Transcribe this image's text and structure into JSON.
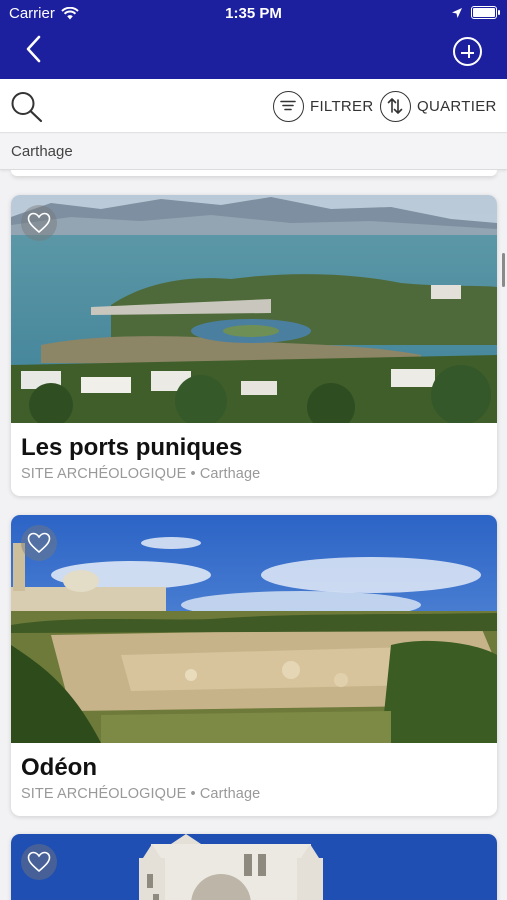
{
  "status_bar": {
    "carrier": "Carrier",
    "time": "1:35 PM"
  },
  "header": {
    "back_icon": "chevron-left-icon",
    "add_icon": "plus-circle-icon"
  },
  "toolbar": {
    "search_icon": "search-icon",
    "filter_label": "FILTRER",
    "quarter_label": "QUARTIER"
  },
  "location": "Carthage",
  "cards": [
    {
      "title": "Les ports puniques",
      "category": "SITE ARCHÉOLOGIQUE",
      "separator": "•",
      "city": "Carthage"
    },
    {
      "title": "Odéon",
      "category": "SITE ARCHÉOLOGIQUE",
      "separator": "•",
      "city": "Carthage"
    }
  ],
  "colors": {
    "header_bg": "#1c1f9e",
    "text_primary": "#111111",
    "text_muted": "#999999"
  }
}
